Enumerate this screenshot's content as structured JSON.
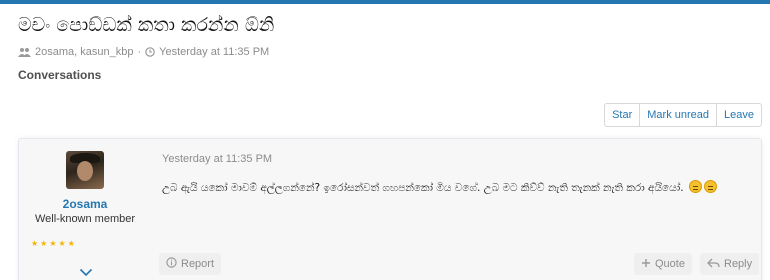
{
  "thread": {
    "title": "මචං පොඞ්ඩක් කතා කරන්න ඕනි",
    "participants": "2osama, kasun_kbp",
    "separator": "·",
    "date": "Yesterday at 11:35 PM"
  },
  "breadcrumb": {
    "label": "Conversations"
  },
  "actions": {
    "star": "Star",
    "mark_unread": "Mark unread",
    "leave": "Leave"
  },
  "message": {
    "author": "2osama",
    "user_title": "Well-known member",
    "rating_stars": 5,
    "date": "Yesterday at 11:35 PM",
    "body": "උබ ඇයි යකෝ මාවම් අල්ලගන්නේ? ඉරෝසන්වත් ගහපන්කෝ මිය වගේ. උබ මට කිව්ව් නැති තැනක් නැති කරා අයියෝ.",
    "emoji_count": 2,
    "report_label": "Report",
    "quote_label": "Quote",
    "reply_label": "Reply"
  },
  "colors": {
    "accent": "#2577b1",
    "muted": "#8c8c8c",
    "star": "#f4b400"
  },
  "icons": {
    "participants": "users-icon",
    "date": "clock-icon",
    "report": "info-circle-icon",
    "quote": "plus-icon",
    "reply": "reply-arrow-icon",
    "expand": "chevron-down-icon"
  }
}
